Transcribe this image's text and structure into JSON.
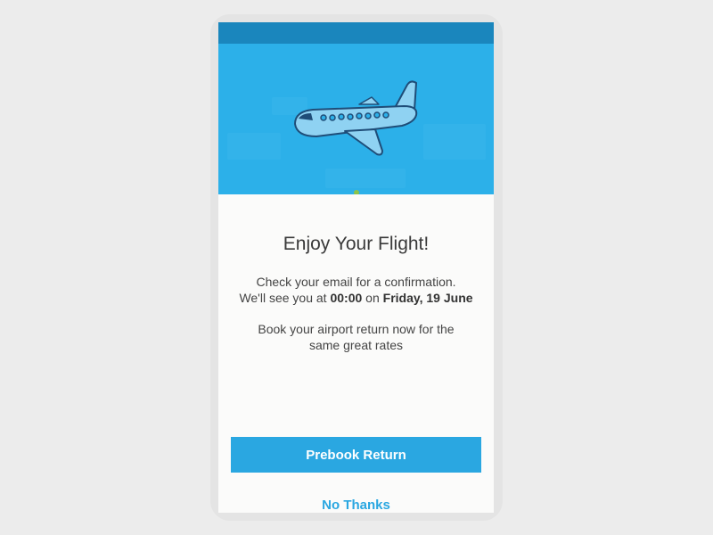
{
  "dialog": {
    "title": "Enjoy Your Flight!",
    "message_line1": "Check your email for a confirmation.",
    "message_line2_prefix": "We'll see you at ",
    "time": "00:00",
    "message_line2_mid": " on ",
    "date": "Friday, 19 June",
    "promo_line1": "Book your airport return now for the",
    "promo_line2": "same great rates",
    "primary_button": "Prebook Return",
    "secondary_button": "No Thanks"
  },
  "hero": {
    "icon": "airplane-icon"
  },
  "colors": {
    "status_bar": "#1a86bd",
    "hero_background": "#2cb0e9",
    "accent": "#2aa7e1",
    "plane_fill": "#8fd2f2",
    "plane_outline": "#1f4d78"
  }
}
